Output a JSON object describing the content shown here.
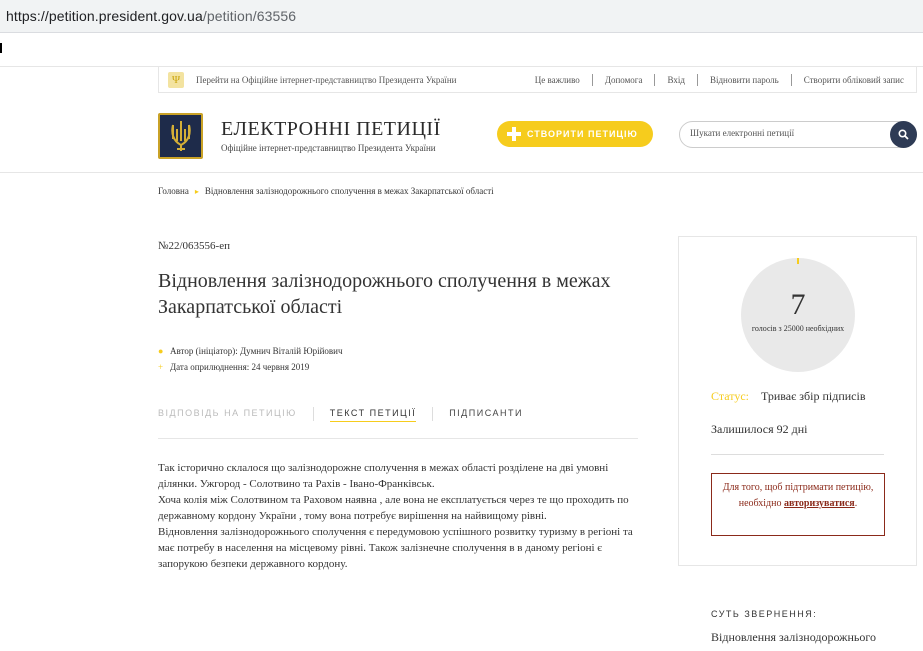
{
  "browser": {
    "url_host": "https://petition.president.gov.ua",
    "url_path": "/petition/63556"
  },
  "topnav": {
    "gov_link": "Перейти на Офіційне інтернет-представництво Президента України",
    "items": [
      "Це важливо",
      "Допомога",
      "Вхід",
      "Відновити пароль",
      "Створити обліковий запис"
    ]
  },
  "header": {
    "title": "ЕЛЕКТРОННІ ПЕТИЦІЇ",
    "subtitle": "Офіційне інтернет-представництво Президента України",
    "create_button": "СТВОРИТИ ПЕТИЦІЮ",
    "search_placeholder": "Шукати електронні петиції"
  },
  "breadcrumb": {
    "home": "Головна",
    "current": "Відновлення залізнодорожнього сполучення в межах Закарпатської області"
  },
  "petition": {
    "number": "№22/063556-еп",
    "title": "Відновлення залізнодорожнього сполучення в межах Закарпатської області",
    "author": "Автор (ініціатор): Думнич Віталій Юрійович",
    "date": "Дата оприлюднення: 24 червня 2019",
    "tabs": [
      "ВІДПОВІДЬ НА ПЕТИЦІЮ",
      "ТЕКСТ ПЕТИЦІЇ",
      "ПІДПИСАНТИ"
    ],
    "text": [
      "Так історично склалося що залізнодорожне сполучення в межах області розділене на дві умовні ділянки. Ужгород - Солотвино та Рахів - Івано-Франківськ.",
      "Хоча колія між Солотвином та Раховом наявна , але вона не експлатується через те що проходить по державному кордону України , тому вона потребує вирішення на найвищому рівні.",
      "Відновлення залізнодорожнього сполучення є передумовою успішного розвитку туризму в регіоні та має потребу в населення на місцевому рівні. Також залізнечне сполучення в в даному регіоні є запорукою безпеки державного кордону."
    ]
  },
  "sidebar": {
    "votes": "7",
    "needed": "голосів з 25000 необхідних",
    "needed_fraction": 0.00028,
    "status_label": "Статус:",
    "status_value": "Триває збір підписів",
    "remaining": "Залишилося 92 дні",
    "auth_text": "Для того, щоб підтримати петицію, необхідно",
    "auth_link": "авторизуватися",
    "auth_end": ".",
    "essence_heading": "СУТЬ ЗВЕРНЕННЯ:",
    "essence_text": "Відновлення залізнодорожнього"
  },
  "colors": {
    "accent": "#f6cc1d",
    "navy": "#2e3b55",
    "alert": "#8b2a1a"
  }
}
